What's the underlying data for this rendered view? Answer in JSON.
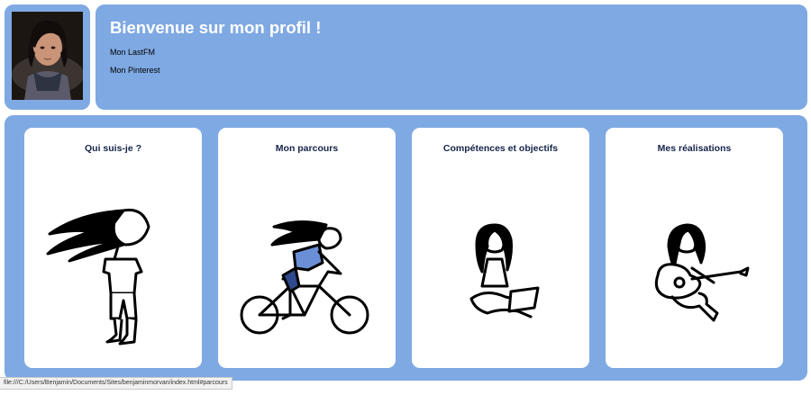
{
  "header": {
    "title": "Bienvenue sur mon profil !",
    "links": [
      {
        "label": "Mon LastFM"
      },
      {
        "label": "Mon Pinterest"
      }
    ]
  },
  "cards": [
    {
      "title": "Qui suis-je ?",
      "icon": "windblown-person-illustration"
    },
    {
      "title": "Mon parcours",
      "icon": "person-on-bicycle-illustration"
    },
    {
      "title": "Compétences et objectifs",
      "icon": "person-with-laptop-illustration"
    },
    {
      "title": "Mes réalisations",
      "icon": "person-with-guitar-illustration"
    }
  ],
  "status_bar": {
    "url": "file:///C:/Users/Benjamin/Documents/Sites/benjaminmorvan/index.html#parcours"
  },
  "colors": {
    "panel": "#7fa9e3",
    "card": "#ffffff",
    "title_text": "#16244a",
    "accent_shirt": "#6b8fd6"
  }
}
